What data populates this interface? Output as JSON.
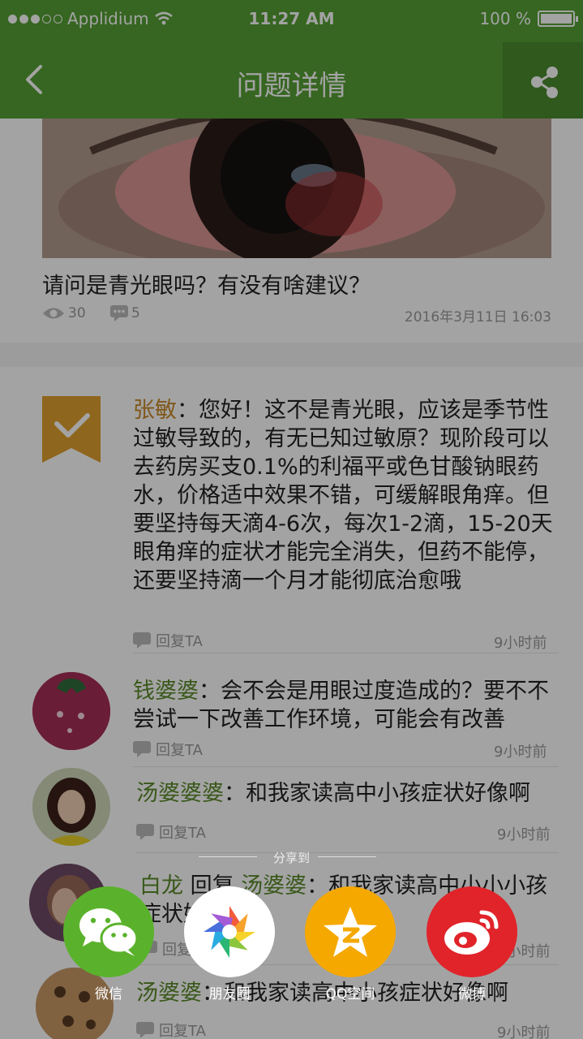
{
  "status": {
    "carrier": "Applidium",
    "time": "11:27 AM",
    "battery": "100 %"
  },
  "nav": {
    "title": "问题详情"
  },
  "question": {
    "text": "请问是青光眼吗？有没有啥建议？",
    "views": "30",
    "comments": "5",
    "date": "2016年3月11日  16:03"
  },
  "answers": [
    {
      "name": "张敏",
      "text": "：您好！这不是青光眼，应该是季节性过敏导致的，有无已知过敏原？现阶段可以去药房买支0.1%的利福平或色甘酸钠眼药水，价格适中效果不错，可缓解眼角痒。但要坚持每天滴4-6次，每次1-2滴，15-20天眼角痒的症状才能完全消失，但药不能停，还要坚持滴一个月才能彻底治愈哦",
      "reply": "回复TA",
      "time": "9小时前"
    },
    {
      "name": "钱婆婆",
      "text": "：会不会是用眼过度造成的？要不不尝试一下改善工作环境，可能会有改善",
      "reply": "回复TA",
      "time": "9小时前"
    },
    {
      "name": "汤婆婆婆",
      "text": "：和我家读高中小孩症状好像啊",
      "reply": "回复TA",
      "time": "9小时前"
    },
    {
      "name": "白龙",
      "mid": " 回复 ",
      "name2": "汤婆婆",
      "text": "：和我家读高中小小小孩症状好像啊",
      "reply": "回复TA",
      "time": "9小时前"
    },
    {
      "name": "汤婆婆",
      "text": "：和我家读高中小孩症状好像啊",
      "reply": "回复TA",
      "time": "9小时前"
    }
  ],
  "share": {
    "title": "分享到",
    "targets": [
      {
        "label": "微信",
        "icon": "wechat-icon",
        "color": "#5ab22c"
      },
      {
        "label": "朋友圈",
        "icon": "moments-icon",
        "color": "#ffffff"
      },
      {
        "label": "QQ空间",
        "icon": "qzone-icon",
        "color": "#f5a800"
      },
      {
        "label": "微博",
        "icon": "weibo-icon",
        "color": "#e0242a"
      }
    ]
  },
  "colors": {
    "brand": "#55a035",
    "brand_dark": "#4a8c2e"
  }
}
